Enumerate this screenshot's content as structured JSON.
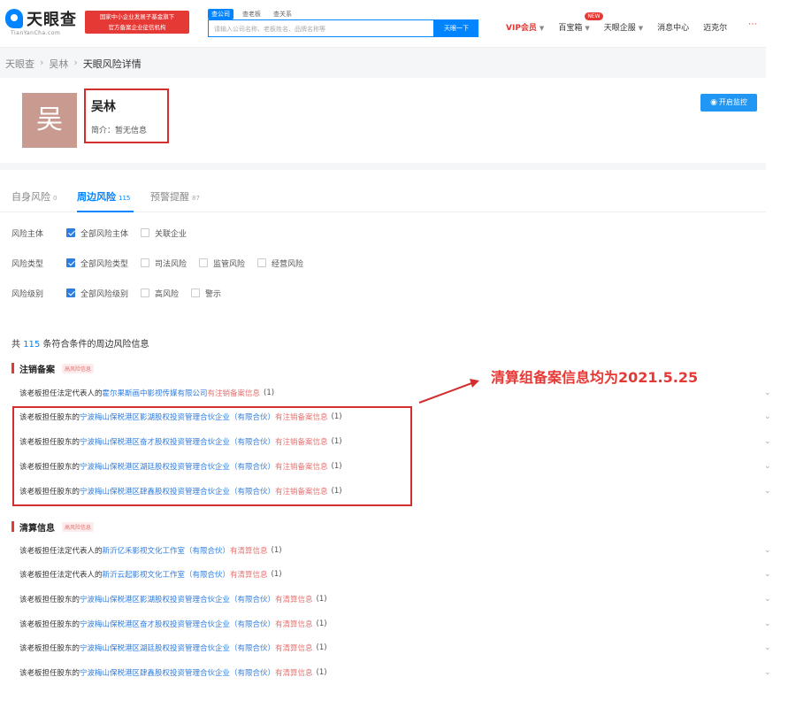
{
  "header": {
    "logo_text": "天眼查",
    "logo_sub": "TianYanCha.com",
    "promo_line1": "国家中小企业发展子基金旗下",
    "promo_line2": "官方备案企业征信机构",
    "search_tabs": [
      "查公司",
      "查老板",
      "查关系"
    ],
    "search_placeholder": "请输入公司名称、老板姓名、品牌名称等",
    "search_button": "天眼一下",
    "nav": {
      "vip": "VIP会员",
      "box": "百宝箱",
      "box_badge": "NEW",
      "enterprise": "天眼企服",
      "messages": "消息中心",
      "user": "迈克尔"
    }
  },
  "breadcrumb": [
    "天眼查",
    "吴林",
    "天眼风险详情"
  ],
  "profile": {
    "avatar_char": "吴",
    "name": "吴林",
    "intro": "简介：暂无信息",
    "monitor_button": "开启监控"
  },
  "risk_tabs": [
    {
      "label": "自身风险",
      "count": "0"
    },
    {
      "label": "周边风险",
      "count": "115"
    },
    {
      "label": "预警提醒",
      "count": "87"
    }
  ],
  "filters": {
    "subject": {
      "label": "风险主体",
      "options": [
        {
          "label": "全部风险主体",
          "checked": true
        },
        {
          "label": "关联企业",
          "checked": false
        }
      ]
    },
    "type": {
      "label": "风险类型",
      "options": [
        {
          "label": "全部风险类型",
          "checked": true
        },
        {
          "label": "司法风险",
          "checked": false
        },
        {
          "label": "监管风险",
          "checked": false
        },
        {
          "label": "经营风险",
          "checked": false
        }
      ]
    },
    "level": {
      "label": "风险级别",
      "options": [
        {
          "label": "全部风险级别",
          "checked": true
        },
        {
          "label": "高风险",
          "checked": false
        },
        {
          "label": "警示",
          "checked": false
        }
      ]
    }
  },
  "summary": {
    "prefix": "共",
    "count": "115",
    "suffix": "条符合条件的周边风险信息"
  },
  "sections": [
    {
      "title": "注销备案",
      "tag": "高风险信息",
      "rows": [
        {
          "prefix": "该老板担任法定代表人的",
          "company": "霍尔果斯画中影视传媒有限公司",
          "flag": "有注销备案信息",
          "count": "(1)"
        },
        {
          "prefix": "该老板担任股东的",
          "company": "宁波梅山保税港区影湖股权投资管理合伙企业（有限合伙）",
          "flag": "有注销备案信息",
          "count": "(1)"
        },
        {
          "prefix": "该老板担任股东的",
          "company": "宁波梅山保税港区奋才股权投资管理合伙企业（有限合伙）",
          "flag": "有注销备案信息",
          "count": "(1)"
        },
        {
          "prefix": "该老板担任股东的",
          "company": "宁波梅山保税港区湖廷股权投资管理合伙企业（有限合伙）",
          "flag": "有注销备案信息",
          "count": "(1)"
        },
        {
          "prefix": "该老板担任股东的",
          "company": "宁波梅山保税港区肆鑫股权投资管理合伙企业（有限合伙）",
          "flag": "有注销备案信息",
          "count": "(1)"
        }
      ]
    },
    {
      "title": "清算信息",
      "tag": "高风险信息",
      "rows": [
        {
          "prefix": "该老板担任法定代表人的",
          "company": "新沂亿禾影视文化工作室（有限合伙）",
          "flag": "有清算信息",
          "count": "(1)"
        },
        {
          "prefix": "该老板担任法定代表人的",
          "company": "新沂云起影视文化工作室（有限合伙）",
          "flag": "有清算信息",
          "count": "(1)"
        },
        {
          "prefix": "该老板担任股东的",
          "company": "宁波梅山保税港区影湖股权投资管理合伙企业（有限合伙）",
          "flag": "有清算信息",
          "count": "(1)"
        },
        {
          "prefix": "该老板担任股东的",
          "company": "宁波梅山保税港区奋才股权投资管理合伙企业（有限合伙）",
          "flag": "有清算信息",
          "count": "(1)"
        },
        {
          "prefix": "该老板担任股东的",
          "company": "宁波梅山保税港区湖廷股权投资管理合伙企业（有限合伙）",
          "flag": "有清算信息",
          "count": "(1)"
        },
        {
          "prefix": "该老板担任股东的",
          "company": "宁波梅山保税港区肆鑫股权投资管理合伙企业（有限合伙）",
          "flag": "有清算信息",
          "count": "(1)"
        }
      ]
    }
  ],
  "annotation": "清算组备案信息均为2021.5.25",
  "colors": {
    "brand_blue": "#0084ff",
    "alert_red": "#e53935",
    "link_blue": "#2f7de1"
  }
}
